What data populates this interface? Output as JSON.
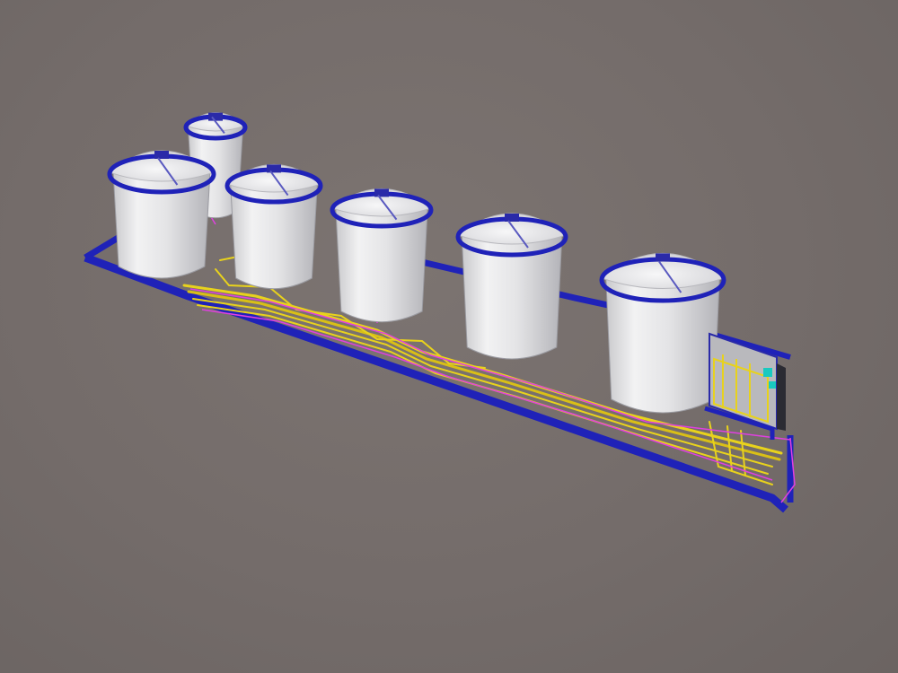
{
  "scene": {
    "background_color": "#736b69",
    "tank_color": "#e6e6e6",
    "tank_rim_color": "#1f22b8",
    "pipe_rack_color": "#e8d21c",
    "pipe_accent_color": "#e040e0",
    "containment_wall_color": "#1f22b8",
    "tank_count": 6,
    "objects": [
      {
        "name": "tank-1"
      },
      {
        "name": "tank-2"
      },
      {
        "name": "tank-3"
      },
      {
        "name": "tank-4"
      },
      {
        "name": "tank-5"
      },
      {
        "name": "tank-6"
      },
      {
        "name": "pump-skid"
      },
      {
        "name": "pipe-rack"
      },
      {
        "name": "containment-wall"
      }
    ]
  }
}
